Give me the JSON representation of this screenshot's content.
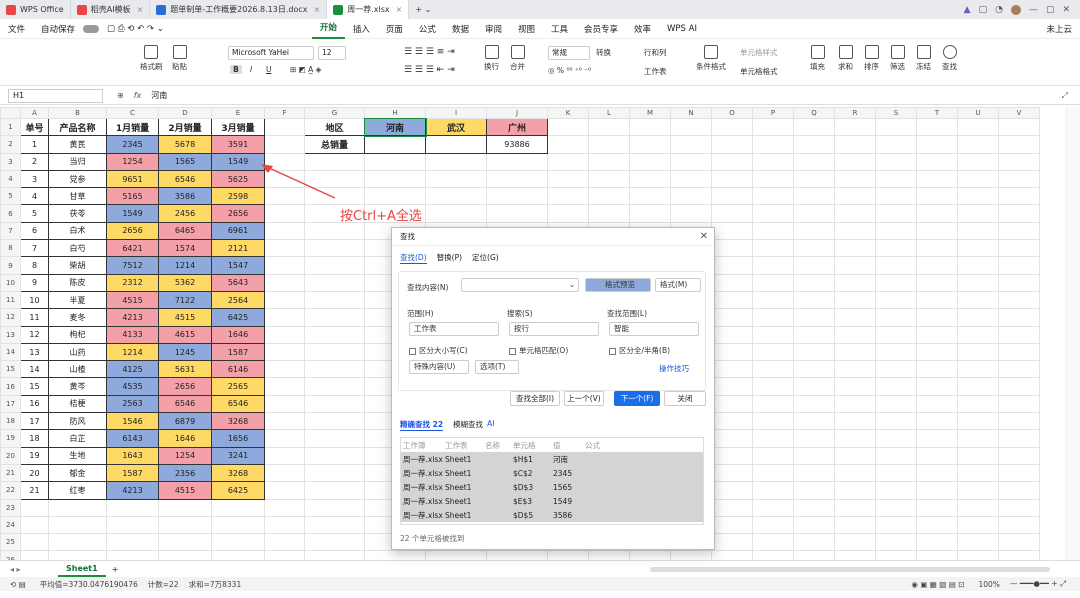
{
  "tabs": [
    {
      "label": "WPS Office",
      "color": "#e84545"
    },
    {
      "label": "稻壳AI模板",
      "color": "#e84545"
    },
    {
      "label": "题单制单-工作概要2026.8.13日.docx",
      "color": "#2b6cd6"
    },
    {
      "label": "周一荐.xlsx",
      "color": "#1a8f3c"
    }
  ],
  "tab_right": [
    "WPS AI",
    "未上云"
  ],
  "menu": {
    "file": "文件",
    "autosave": "自动保存",
    "items": [
      "开始",
      "插入",
      "页面",
      "公式",
      "数据",
      "审阅",
      "视图",
      "工具",
      "会员专享",
      "效率",
      "WPS AI"
    ],
    "selected": "开始",
    "share": "未上云"
  },
  "ribbon": {
    "format_painter": "格式刷",
    "paste": "粘贴",
    "font": "Microsoft YaHei",
    "size": "12",
    "bold": "B",
    "italic": "I",
    "underline": "U",
    "wrap": "换行",
    "merge": "合并",
    "numfmt": "常规",
    "convert": "转换",
    "rowcol": "行和列",
    "worksheet": "工作表",
    "cond": "条件格式",
    "cellstyle": "单元格样式",
    "cellfmt": "单元格格式",
    "fill": "填充",
    "sum": "求和",
    "sort": "排序",
    "filter": "筛选",
    "freeze": "冻结",
    "find": "查找"
  },
  "formula": {
    "cell": "H1",
    "fx": "fx",
    "value": "河南"
  },
  "columns": [
    "A",
    "B",
    "C",
    "D",
    "E",
    "F",
    "G",
    "H",
    "I",
    "J",
    "K",
    "L",
    "M",
    "N",
    "O",
    "P",
    "Q",
    "R",
    "S",
    "T",
    "U",
    "V"
  ],
  "headers": [
    "单号",
    "产品名称",
    "1月销量",
    "2月销量",
    "3月销量"
  ],
  "rows": [
    [
      "1",
      "黄芪",
      "2345",
      "5678",
      "3591",
      "b",
      "y",
      "p"
    ],
    [
      "2",
      "当归",
      "1254",
      "1565",
      "1549",
      "p",
      "b",
      "b"
    ],
    [
      "3",
      "党参",
      "9651",
      "6546",
      "5625",
      "y",
      "y",
      "p"
    ],
    [
      "4",
      "甘草",
      "5165",
      "3586",
      "2598",
      "p",
      "b",
      "y"
    ],
    [
      "5",
      "茯苓",
      "1549",
      "2456",
      "2656",
      "b",
      "y",
      "p"
    ],
    [
      "6",
      "白术",
      "2656",
      "6465",
      "6961",
      "y",
      "p",
      "b"
    ],
    [
      "7",
      "白芍",
      "6421",
      "1574",
      "2121",
      "p",
      "p",
      "y"
    ],
    [
      "8",
      "柴胡",
      "7512",
      "1214",
      "1547",
      "b",
      "b",
      "b"
    ],
    [
      "9",
      "陈皮",
      "2312",
      "5362",
      "5643",
      "y",
      "y",
      "p"
    ],
    [
      "10",
      "半夏",
      "4515",
      "7122",
      "2564",
      "p",
      "b",
      "y"
    ],
    [
      "11",
      "麦冬",
      "4213",
      "4515",
      "6425",
      "p",
      "y",
      "b"
    ],
    [
      "12",
      "枸杞",
      "4133",
      "4615",
      "1646",
      "p",
      "p",
      "p"
    ],
    [
      "13",
      "山药",
      "1214",
      "1245",
      "1587",
      "y",
      "b",
      "p"
    ],
    [
      "14",
      "山楂",
      "4125",
      "5631",
      "6146",
      "b",
      "y",
      "p"
    ],
    [
      "15",
      "黄芩",
      "4535",
      "2656",
      "2565",
      "b",
      "p",
      "y"
    ],
    [
      "16",
      "桔梗",
      "2563",
      "6546",
      "6546",
      "b",
      "p",
      "y"
    ],
    [
      "17",
      "防风",
      "1546",
      "6879",
      "3268",
      "y",
      "b",
      "p"
    ],
    [
      "18",
      "白芷",
      "6143",
      "1646",
      "1656",
      "b",
      "y",
      "b"
    ],
    [
      "19",
      "生地",
      "1643",
      "1254",
      "3241",
      "y",
      "p",
      "b"
    ],
    [
      "20",
      "郁金",
      "1587",
      "2356",
      "3268",
      "y",
      "b",
      "y"
    ],
    [
      "21",
      "红枣",
      "4213",
      "4515",
      "6425",
      "b",
      "p",
      "y"
    ]
  ],
  "summary": {
    "region": "地区",
    "henan": "河南",
    "wuhan": "武汉",
    "guangzhou": "广州",
    "total": "总销量",
    "gz_total": "93886"
  },
  "annotation": "按Ctrl+A全选",
  "dialog": {
    "title": "查找",
    "tabs": [
      "查找(D)",
      "替换(P)",
      "定位(G)"
    ],
    "find_label": "查找内容(N)",
    "preview": "格式预览",
    "format": "格式(M)",
    "scope_label": "范围(H)",
    "scope": "工作表",
    "search_label": "搜索(S)",
    "search": "按行",
    "lookin_label": "查找范围(L)",
    "lookin": "智能",
    "case": "区分大小写(C)",
    "whole": "单元格匹配(O)",
    "width": "区分全/半角(B)",
    "special": "特殊内容(U)",
    "options": "选项(T)",
    "tips": "操作技巧",
    "find_all": "查找全部(I)",
    "prev": "上一个(V)",
    "next": "下一个(F)",
    "close": "关闭",
    "exact": "精确查找 22",
    "fuzzy": "模糊查找",
    "ai": "AI",
    "cols": [
      "工作簿",
      "工作表",
      "名称",
      "单元格",
      "值",
      "公式"
    ],
    "results": [
      [
        "周一荐.xlsx",
        "Sheet1",
        "",
        "$H$1",
        "河南"
      ],
      [
        "周一荐.xlsx",
        "Sheet1",
        "",
        "$C$2",
        "2345"
      ],
      [
        "周一荐.xlsx",
        "Sheet1",
        "",
        "$D$3",
        "1565"
      ],
      [
        "周一荐.xlsx",
        "Sheet1",
        "",
        "$E$3",
        "1549"
      ],
      [
        "周一荐.xlsx",
        "Sheet1",
        "",
        "$D$5",
        "3586"
      ]
    ],
    "found": "22 个单元格被找到"
  },
  "sheet_tab": "Sheet1",
  "status": {
    "avg": "平均值=3730.0476190476",
    "count": "计数=22",
    "sum": "求和=7万8331",
    "zoom": "100%"
  },
  "colors": {
    "blue": "#8ea9db",
    "yellow": "#ffd966",
    "pink": "#f4a0a8",
    "accent": "#1a8f3c"
  }
}
